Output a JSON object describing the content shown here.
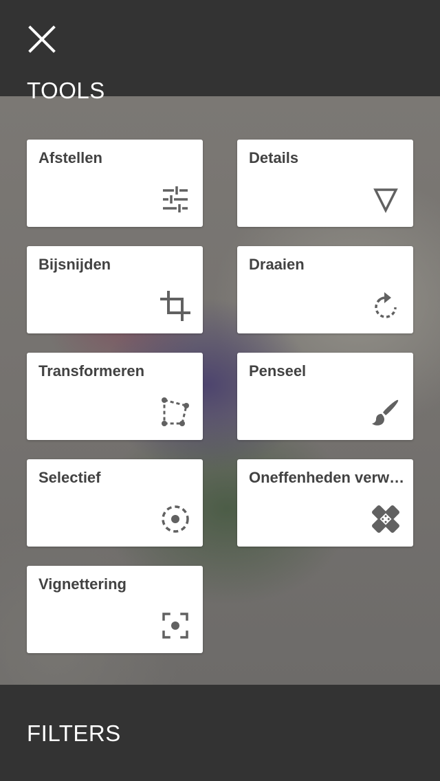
{
  "header": {
    "close_icon": "close-icon",
    "tools_title": "TOOLS"
  },
  "tools": [
    {
      "label": "Afstellen",
      "icon": "tune-icon"
    },
    {
      "label": "Details",
      "icon": "details-triangle-icon"
    },
    {
      "label": "Bijsnijden",
      "icon": "crop-icon"
    },
    {
      "label": "Draaien",
      "icon": "rotate-icon"
    },
    {
      "label": "Transformeren",
      "icon": "perspective-icon"
    },
    {
      "label": "Penseel",
      "icon": "brush-icon"
    },
    {
      "label": "Selectief",
      "icon": "selective-icon"
    },
    {
      "label": "Oneffenheden verwijderen",
      "icon": "healing-icon"
    },
    {
      "label": "Vignettering",
      "icon": "vignette-icon"
    }
  ],
  "footer": {
    "filters_title": "FILTERS"
  },
  "colors": {
    "bar_background": "#333333",
    "card_background": "#ffffff",
    "card_text": "#424242",
    "icon_color": "#616161"
  }
}
